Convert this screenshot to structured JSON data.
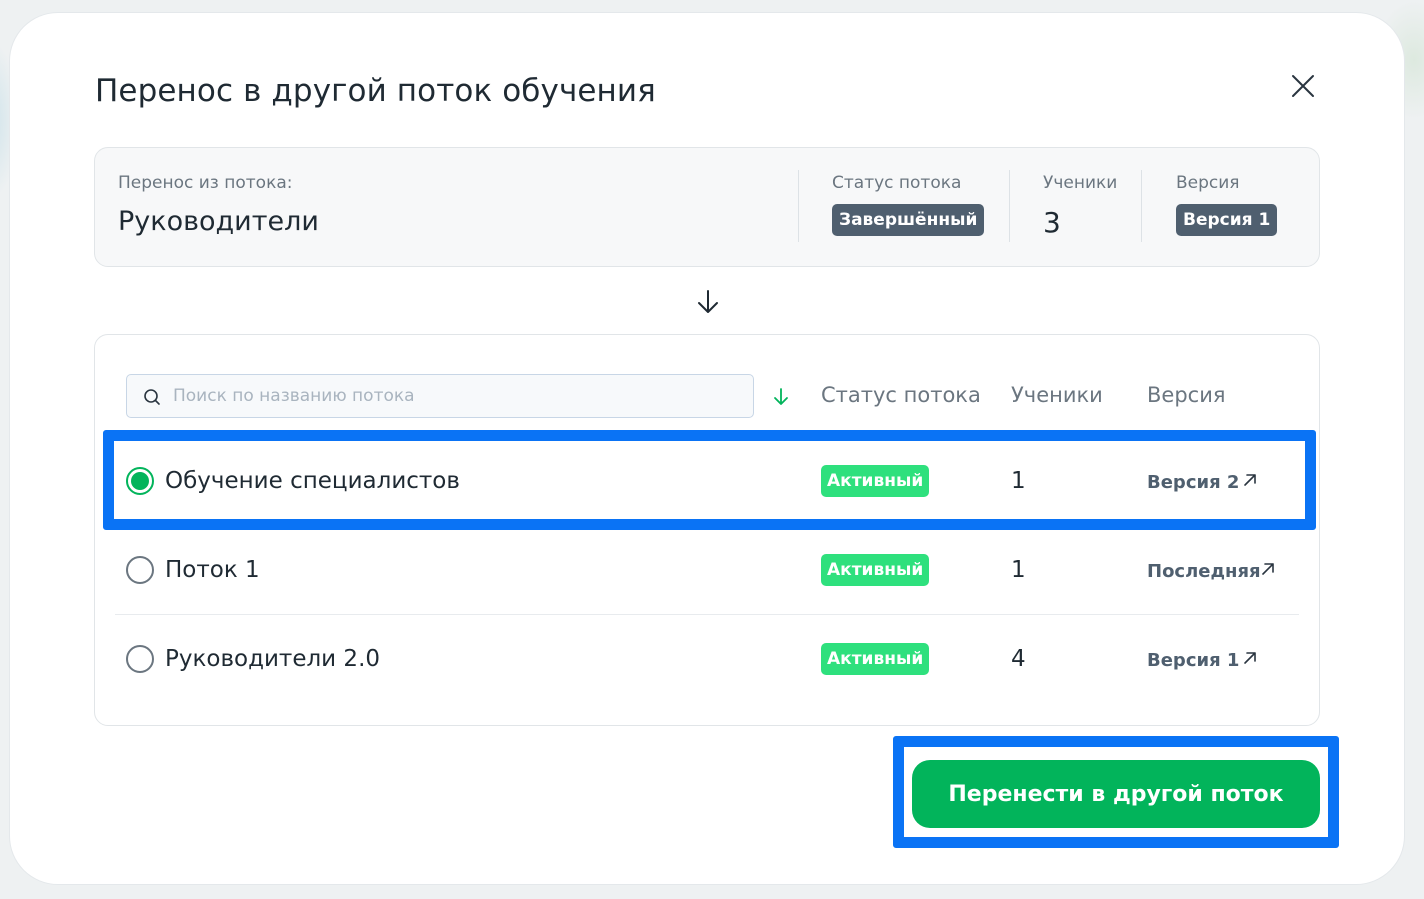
{
  "modal": {
    "title": "Перенос в другой поток обучения"
  },
  "source": {
    "label": "Перенос из потока:",
    "name": "Руководители",
    "status_label": "Статус потока",
    "status_value": "Завершённый",
    "students_label": "Ученики",
    "students_value": "3",
    "version_label": "Версия",
    "version_value": "Версия 1"
  },
  "list": {
    "search_placeholder": "Поиск по названию потока",
    "headers": {
      "status": "Статус потока",
      "students": "Ученики",
      "version": "Версия"
    },
    "rows": [
      {
        "name": "Обучение специалистов",
        "status": "Активный",
        "students": "1",
        "version": "Версия 2",
        "selected": true
      },
      {
        "name": "Поток 1",
        "status": "Активный",
        "students": "1",
        "version": "Последняя",
        "selected": false
      },
      {
        "name": "Руководители 2.0",
        "status": "Активный",
        "students": "4",
        "version": "Версия 1",
        "selected": false
      }
    ]
  },
  "actions": {
    "submit_label": "Перенести в другой поток"
  },
  "colors": {
    "accent_green": "#02b45b",
    "badge_green": "#2ee07d",
    "badge_dark": "#4f5f6f",
    "highlight_blue": "#0a73f5"
  },
  "icons": {
    "close": "close-icon",
    "arrow_down": "arrow-down-icon",
    "search": "search-icon",
    "sort": "sort-arrow-down-icon",
    "external": "external-link-icon"
  }
}
